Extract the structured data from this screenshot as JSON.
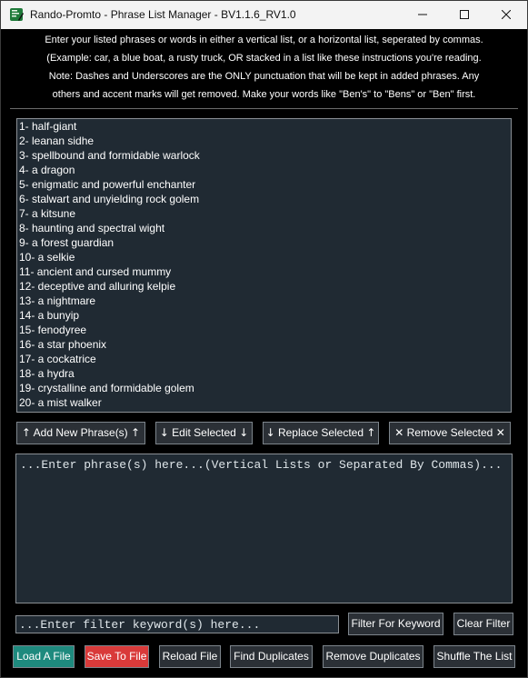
{
  "window": {
    "title": "Rando-Promto - Phrase List Manager - BV1.1.6_RV1.0"
  },
  "instructions": [
    "Enter your listed phrases or words in either a vertical list, or a horizontal list, seperated by commas.",
    "(Example: car, a blue boat, a rusty truck, OR stacked in a list like these instructions you're reading.",
    "Note: Dashes and Underscores are the ONLY punctuation that will be kept in added phrases. Any",
    "others and accent marks will get removed. Make your words like \"Ben's\" to \"Bens\" or \"Ben\" first."
  ],
  "phrases": [
    "1- half-giant",
    "2- leanan sidhe",
    "3- spellbound and formidable warlock",
    "4- a dragon",
    "5- enigmatic and powerful enchanter",
    "6- stalwart and unyielding rock golem",
    "7- a kitsune",
    "8- haunting and spectral wight",
    "9- a forest guardian",
    "10- a selkie",
    "11- ancient and cursed mummy",
    "12- deceptive and alluring kelpie",
    "13- a nightmare",
    "14- a bunyip",
    "15- fenodyree",
    "16- a star phoenix",
    "17- a cockatrice",
    "18- a hydra",
    "19- crystalline and formidable golem",
    "20- a mist walker"
  ],
  "list_actions": {
    "add": "Add New Phrase(s)",
    "edit": "Edit Selected",
    "replace": "Replace Selected",
    "remove": "Remove Selected"
  },
  "phrase_input": {
    "placeholder": "...Enter phrase(s) here...(Vertical Lists or Separated By Commas)..."
  },
  "filter": {
    "placeholder": "...Enter filter keyword(s) here...",
    "filter_button": "Filter For Keyword",
    "clear_button": "Clear Filter"
  },
  "file_actions": {
    "load": "Load A File",
    "save": "Save To File",
    "reload": "Reload File",
    "find_duplicates": "Find Duplicates",
    "remove_duplicates": "Remove Duplicates",
    "shuffle": "Shuffle The List"
  },
  "colors": {
    "load_button": "#1e8a7e",
    "save_button": "#d93a3a",
    "panel_bg": "#202a33",
    "button_bg": "#2b3036"
  }
}
